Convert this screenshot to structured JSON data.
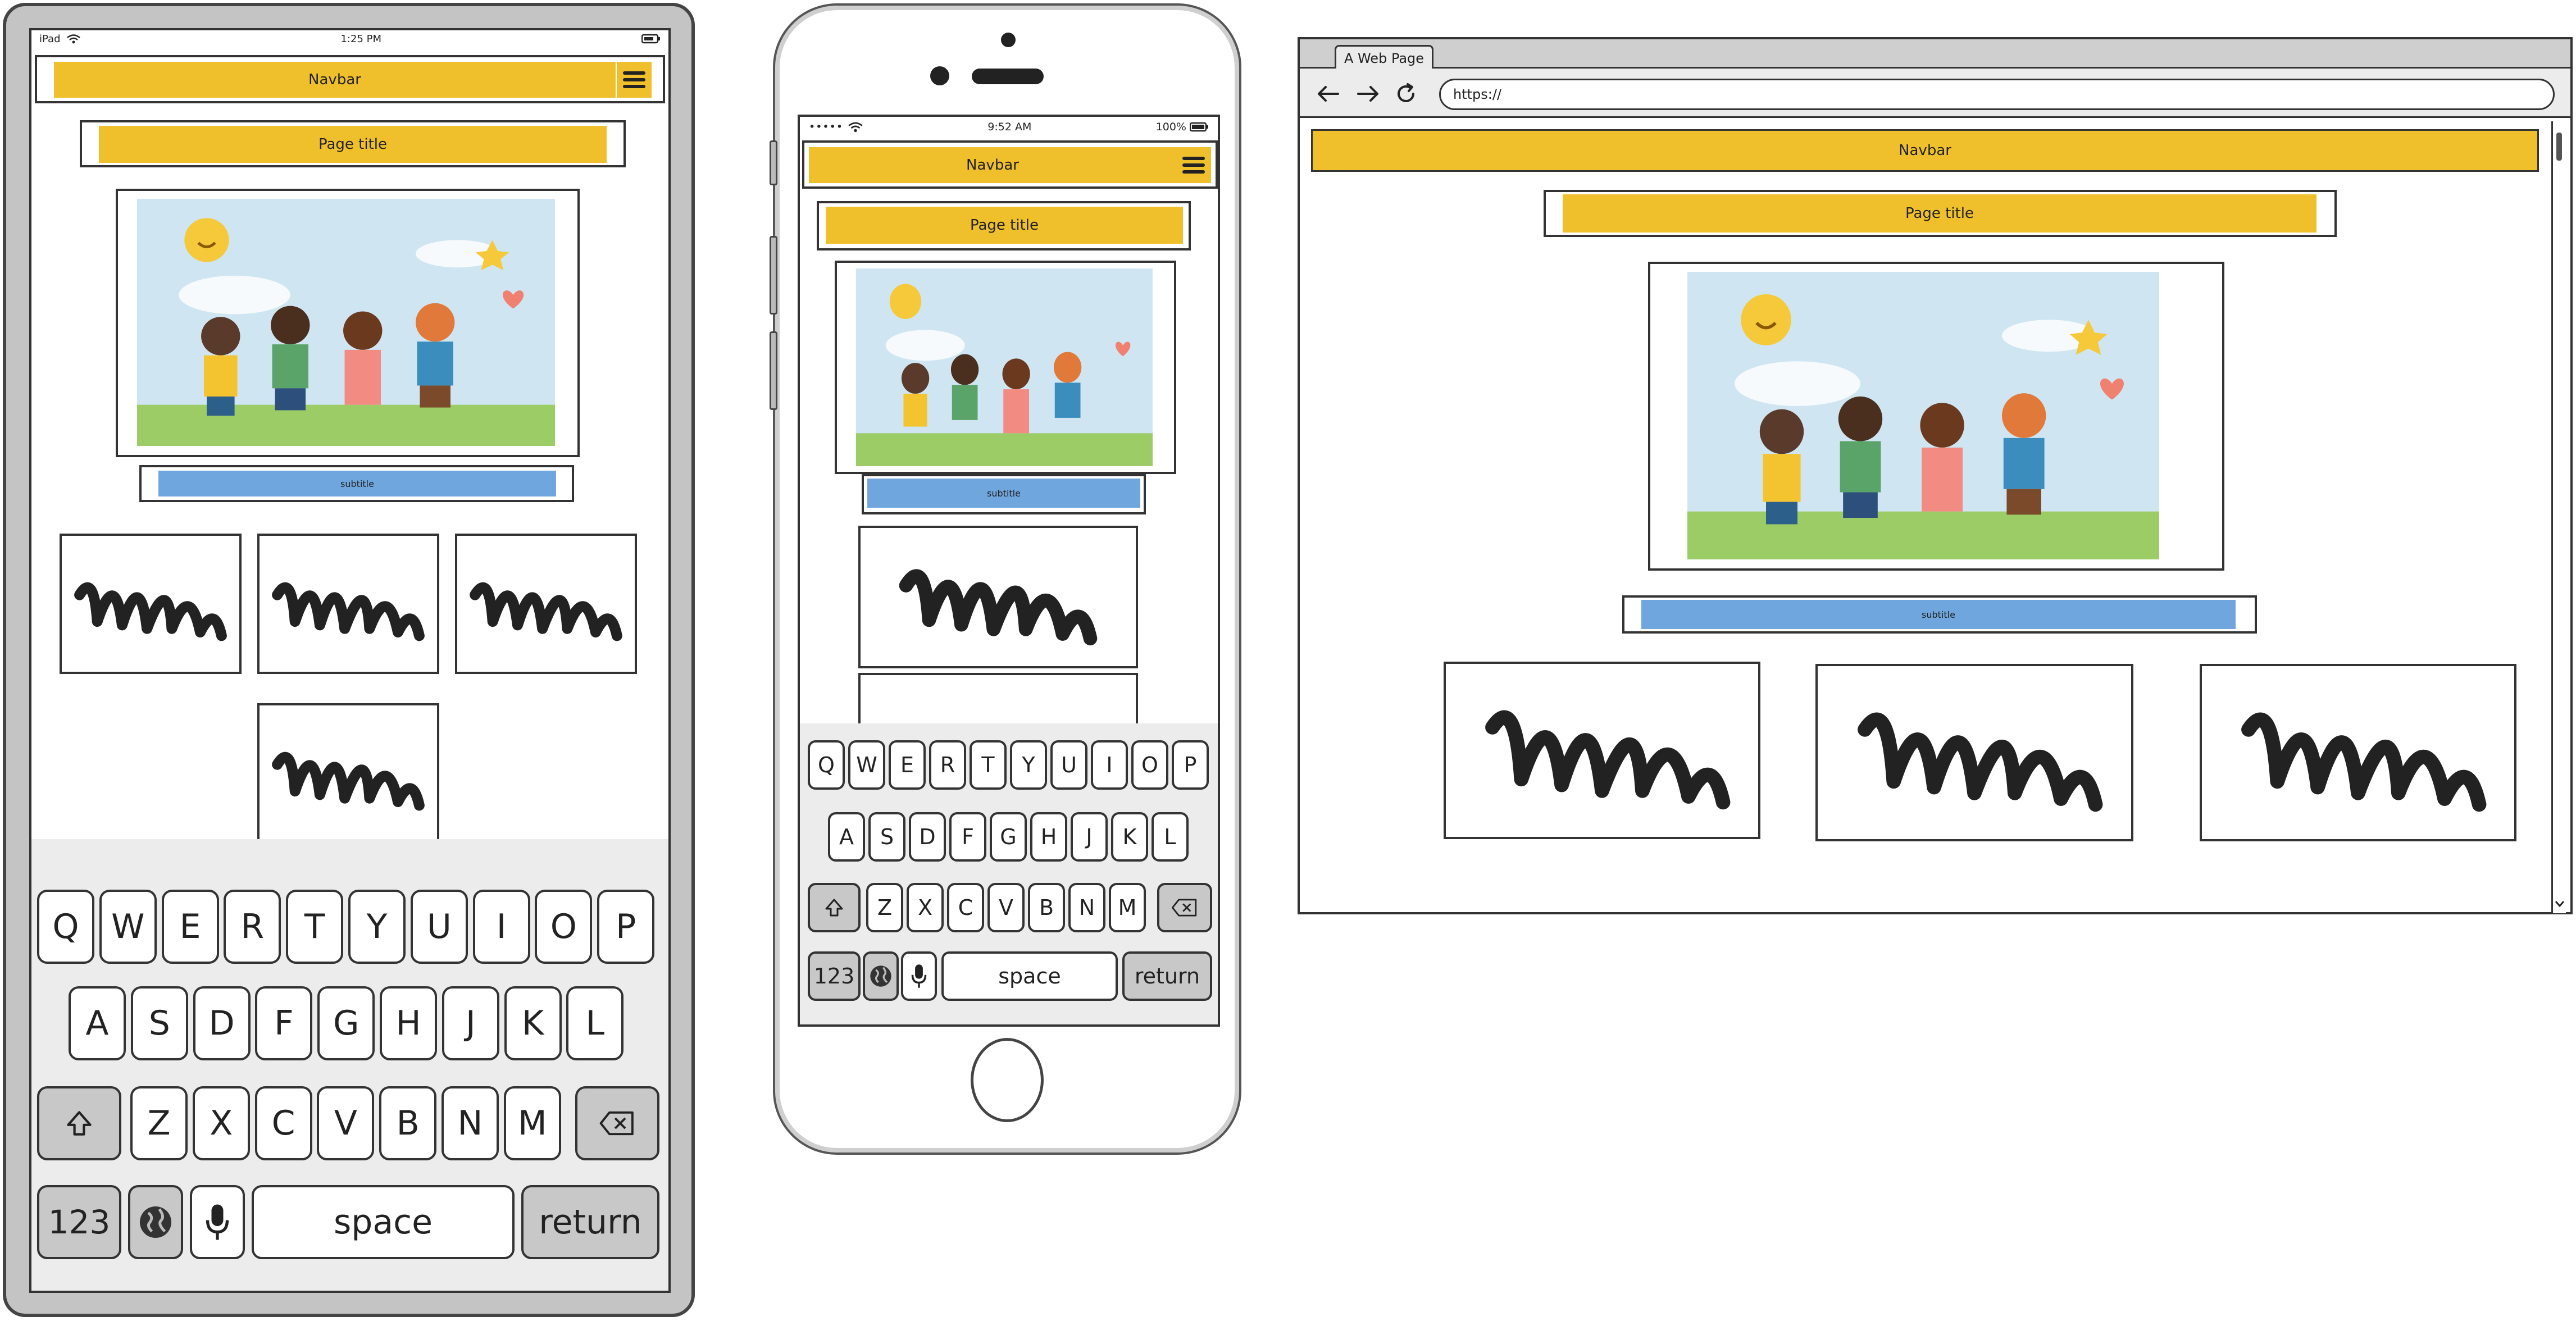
{
  "tablet": {
    "status": {
      "left": "iPad",
      "time": "1:25 PM"
    },
    "navbar_label": "Navbar",
    "page_title": "Page title",
    "subtitle": "subtitle"
  },
  "phone": {
    "status": {
      "signal": "•••••",
      "time": "9:52 AM",
      "battery": "100%"
    },
    "navbar_label": "Navbar",
    "page_title": "Page title",
    "subtitle": "subtitle"
  },
  "browser": {
    "tab_title": "A Web Page",
    "url": "https://",
    "navbar_label": "Navbar",
    "page_title": "Page title",
    "subtitle": "subtitle"
  },
  "keyboard": {
    "row1": [
      "Q",
      "W",
      "E",
      "R",
      "T",
      "Y",
      "U",
      "I",
      "O",
      "P"
    ],
    "row2": [
      "A",
      "S",
      "D",
      "F",
      "G",
      "H",
      "J",
      "K",
      "L"
    ],
    "row3": [
      "Z",
      "X",
      "C",
      "V",
      "B",
      "N",
      "M"
    ],
    "numbers_label": "123",
    "space_label": "space",
    "return_label": "return"
  },
  "colors": {
    "accent_yellow": "#f0c02c",
    "accent_blue": "#6fa6de",
    "outline": "#333333",
    "device_gray": "#c4c4c4"
  },
  "icons": [
    "wifi-icon",
    "battery-icon",
    "hamburger-menu-icon",
    "back-arrow-icon",
    "forward-arrow-icon",
    "reload-icon",
    "shift-icon",
    "backspace-icon",
    "globe-icon",
    "microphone-icon"
  ]
}
